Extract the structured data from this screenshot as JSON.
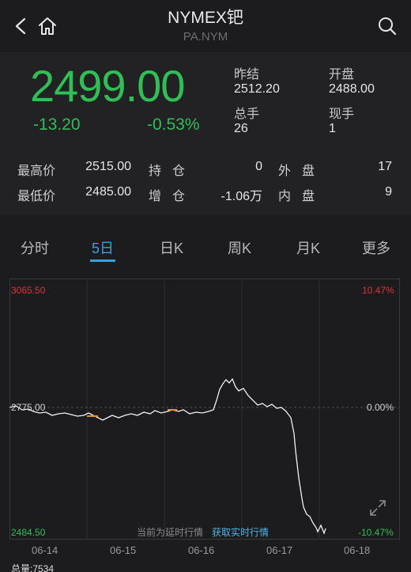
{
  "header": {
    "title": "NYMEX钯",
    "subtitle": "PA.NYM"
  },
  "quote": {
    "price": "2499.00",
    "change": "-13.20",
    "change_pct": "-0.53%",
    "prev_close_label": "昨结",
    "prev_close": "2512.20",
    "open_label": "开盘",
    "open": "2488.00",
    "total_vol_label": "总手",
    "total_vol": "26",
    "current_vol_label": "现手",
    "current_vol": "1"
  },
  "stats": {
    "high_label": "最高价",
    "high": "2515.00",
    "low_label": "最低价",
    "low": "2485.00",
    "position_label": "持仓",
    "position": "0",
    "increase_label": "增仓",
    "increase": "-1.06万",
    "outer_label": "外盘",
    "outer": "17",
    "inner_label": "内盘",
    "inner": "9"
  },
  "tabs": [
    "分时",
    "5日",
    "日K",
    "周K",
    "月K",
    "更多"
  ],
  "active_tab": 1,
  "chart": {
    "y_top_left": "3065.50",
    "y_mid_left": "2775.00",
    "y_bottom_left": "2484.50",
    "y_top_right": "10.47%",
    "y_mid_right": "0.00%",
    "y_bottom_right": "-10.47%",
    "dates": [
      "06-14",
      "06-15",
      "06-16",
      "06-17",
      "06-18"
    ],
    "delay_note": "当前为延时行情",
    "realtime_link": "获取实时行情",
    "volume_label": "总量:7534"
  },
  "colors": {
    "up": "#e0303a",
    "down": "#2fbf55",
    "accent": "#3aa0e0"
  }
}
